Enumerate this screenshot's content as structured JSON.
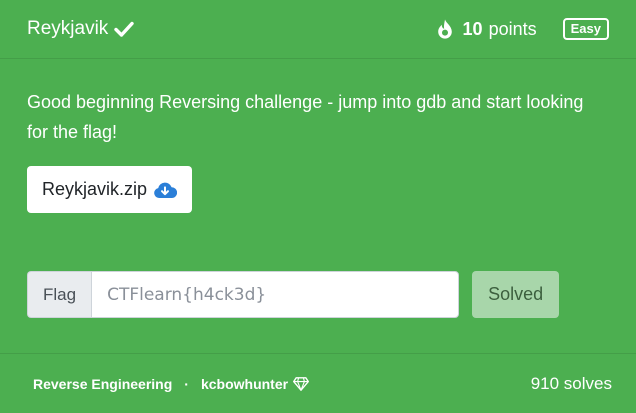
{
  "header": {
    "title": "Reykjavik",
    "points_value": "10",
    "points_unit": "points",
    "difficulty": "Easy"
  },
  "body": {
    "description": "Good beginning Reversing challenge - jump into gdb and start looking for the flag!",
    "file_label": "Reykjavik.zip"
  },
  "flag_form": {
    "prefix": "Flag",
    "value": "CTFlearn{h4ck3d}",
    "submit_label": "Solved"
  },
  "footer": {
    "category": "Reverse Engineering",
    "separator": "·",
    "author": "kcbowhunter",
    "solves": "910 solves"
  },
  "colors": {
    "card_background": "#4caf50",
    "solved_button": "#a8d6aa",
    "download_icon": "#2b7fd8"
  },
  "icons": {
    "title_status": "check-icon",
    "points": "fire-icon",
    "download": "cloud-download-icon",
    "author_badge": "diamond-icon"
  }
}
